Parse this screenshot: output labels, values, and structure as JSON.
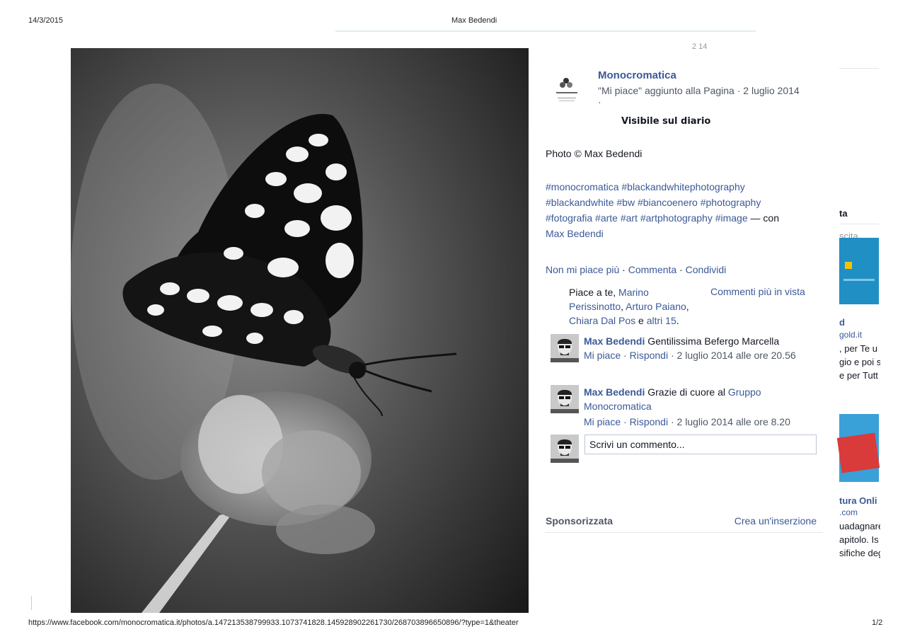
{
  "header": {
    "date": "14/3/2015",
    "title": "Max Bedendi"
  },
  "top_counter": "2 14",
  "post": {
    "page_name": "Monocromatica",
    "meta": "\"Mi piace\" aggiunto alla Pagina · 2 luglio 2014",
    "meta_dot": "·",
    "visibility": "Visibile sul diario",
    "caption": "Photo © Max Bedendi",
    "hashtags": {
      "line1": "#monocromatica #blackandwhitephotography",
      "line2": "#blackandwhite #bw #biancoenero #photography",
      "line3": "#fotografia #arte #art #artphotography #image",
      "with_text": " — con",
      "with_name": "Max Bedendi"
    },
    "actions": {
      "unlike": "Non mi piace più",
      "comment": "Commenta",
      "share": "Condividi",
      "sep": " · "
    },
    "likes": {
      "prefix": "Piace a te, ",
      "name1": "Marino Perissinotto",
      "comma": ", ",
      "name2": "Arturo Paiano",
      "comma2": ",",
      "name3": "Chiara Dal Pos",
      "and": " e ",
      "others": "altri 15",
      "end": "."
    },
    "most_relevant": "Commenti più in vista",
    "comments": [
      {
        "author": "Max Bedendi",
        "text": "Gentilissima Befergo Marcella",
        "like": "Mi piace",
        "reply": "Rispondi",
        "time": "2 luglio 2014 alle ore 20.56"
      },
      {
        "author": "Max Bedendi",
        "text": "Grazie di cuore al ",
        "link": "Gruppo Monocromatica",
        "like": "Mi piace",
        "reply": "Rispondi",
        "time": "2 luglio 2014 alle ore 8.20"
      }
    ],
    "comment_placeholder": "Scrivi un commento..."
  },
  "sponsored": {
    "label": "Sponsorizzata",
    "create_ad": "Crea un'inserzione"
  },
  "right_column": {
    "heading": "ta",
    "sub": "scita",
    "ad1_title": "d",
    "ad1_domain": "gold.it",
    "ad1_lines": [
      ", per Te u",
      "gio e poi s",
      "e per Tutt"
    ],
    "ad2_title": "tura Onli",
    "ad2_domain": ".com",
    "ad2_lines": [
      "uadagnare",
      "apitolo. Is",
      "sifiche deg"
    ]
  },
  "footer": {
    "url": "https://www.facebook.com/monocromatica.it/photos/a.147213538799933.1073741828.145928902261730/268703896650896/?type=1&theater",
    "page": "1/2"
  },
  "colors": {
    "link": "#3b5998",
    "text": "#141823",
    "muted": "#4e5665"
  }
}
